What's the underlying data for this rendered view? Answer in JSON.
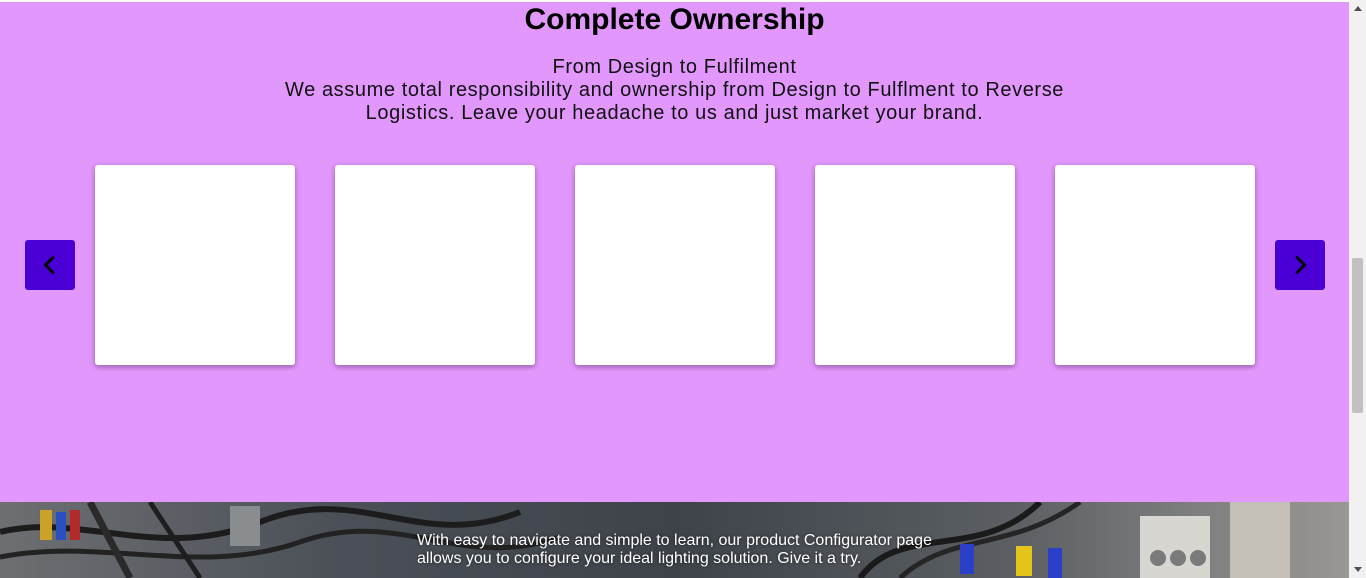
{
  "ownership": {
    "title": "Complete Ownership",
    "subtitle": "From Design to Fulfilment",
    "description": "We assume total responsibility and ownership from Design to Fulflment to Reverse Logistics. Leave your headache to us and just market your brand.",
    "background_color": "#e297fd",
    "carousel": {
      "prev_icon": "chevron-left-icon",
      "next_icon": "chevron-right-icon",
      "arrow_color": "#4a00d4",
      "cards": [
        {
          "name": "carousel-card-1"
        },
        {
          "name": "carousel-card-2"
        },
        {
          "name": "carousel-card-3"
        },
        {
          "name": "carousel-card-4"
        },
        {
          "name": "carousel-card-5"
        }
      ]
    }
  },
  "configurator": {
    "text": "With easy to navigate and simple to learn, our product Configurator page allows you to configure your ideal lighting solution. Give it a try."
  }
}
